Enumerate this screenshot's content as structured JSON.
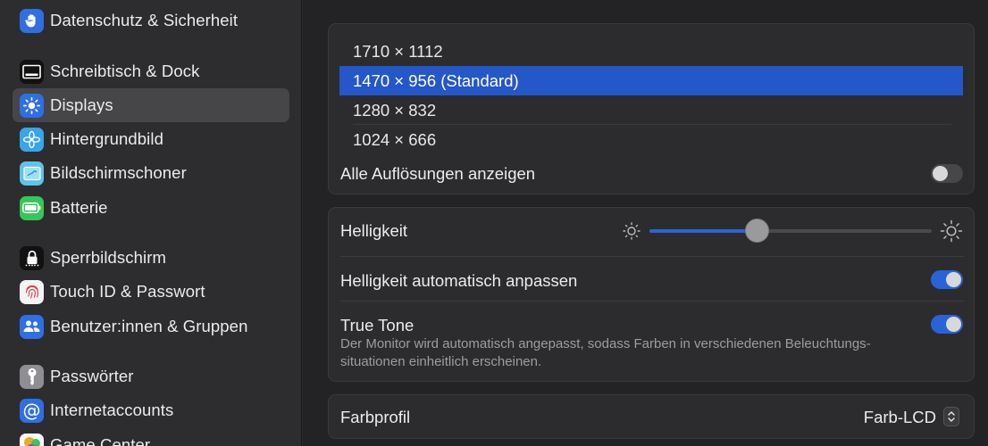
{
  "sidebar": {
    "items": [
      {
        "label": "Datenschutz & Sicherheit",
        "icon": "hand-icon"
      },
      {
        "label": "Schreibtisch & Dock",
        "icon": "dock-icon"
      },
      {
        "label": "Displays",
        "icon": "sun-icon"
      },
      {
        "label": "Hintergrundbild",
        "icon": "flower-icon"
      },
      {
        "label": "Bildschirmschoner",
        "icon": "screensaver-icon"
      },
      {
        "label": "Batterie",
        "icon": "battery-icon"
      },
      {
        "label": "Sperrbildschirm",
        "icon": "lock-icon"
      },
      {
        "label": "Touch ID & Passwort",
        "icon": "fingerprint-icon"
      },
      {
        "label": "Benutzer:innen & Gruppen",
        "icon": "users-icon"
      },
      {
        "label": "Passwörter",
        "icon": "key-icon"
      },
      {
        "label": "Internetaccounts",
        "icon": "at-icon"
      },
      {
        "label": "Game Center",
        "icon": "game-center-icon"
      }
    ],
    "selected": "Displays"
  },
  "resolutions": {
    "options": [
      "1710 × 1112",
      "1470 × 956 (Standard)",
      "1280 × 832",
      "1024 × 666"
    ],
    "selected": "1470 × 956 (Standard)",
    "show_all_label": "Alle Auflösungen anzeigen",
    "show_all_enabled": false
  },
  "brightness": {
    "label": "Helligkeit",
    "level": 0.38,
    "auto_label": "Helligkeit automatisch anpassen",
    "auto_enabled": true,
    "true_tone_label": "True Tone",
    "true_tone_desc": "Der Monitor wird automatisch angepasst, sodass Farben in verschiedenen Beleuchtungs- situationen einheitlich erscheinen.",
    "true_tone_enabled": true
  },
  "color_profile": {
    "label": "Farbprofil",
    "value": "Farb-LCD"
  },
  "colors": {
    "accent": "#2457c8",
    "toggle_on": "#2a63d6"
  }
}
